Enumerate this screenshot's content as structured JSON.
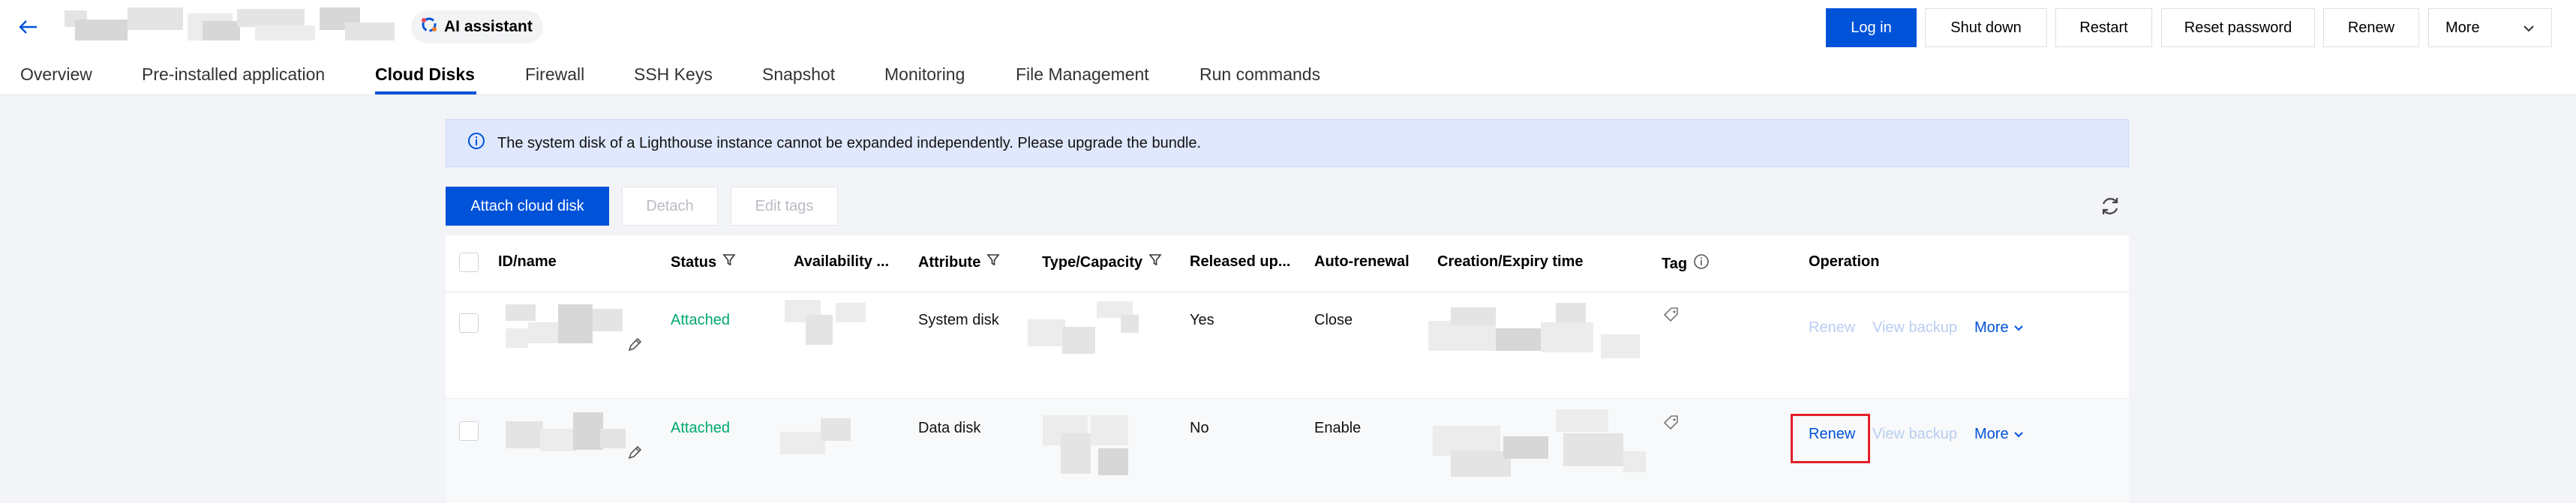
{
  "header": {
    "ai_assistant_label": "AI assistant",
    "buttons": {
      "login": "Log in",
      "shutdown": "Shut down",
      "restart": "Restart",
      "reset_password": "Reset password",
      "renew": "Renew",
      "more": "More"
    }
  },
  "tabs": [
    {
      "label": "Overview"
    },
    {
      "label": "Pre-installed application"
    },
    {
      "label": "Cloud Disks",
      "active": true
    },
    {
      "label": "Firewall"
    },
    {
      "label": "SSH Keys"
    },
    {
      "label": "Snapshot"
    },
    {
      "label": "Monitoring"
    },
    {
      "label": "File Management"
    },
    {
      "label": "Run commands"
    }
  ],
  "notice": {
    "text": "The system disk of a Lighthouse instance cannot be expanded independently. Please upgrade the bundle."
  },
  "toolbar": {
    "attach_label": "Attach cloud disk",
    "detach_label": "Detach",
    "edit_tags_label": "Edit tags"
  },
  "table": {
    "columns": {
      "id_name": "ID/name",
      "status": "Status",
      "availability": "Availability ...",
      "attribute": "Attribute",
      "type_capacity": "Type/Capacity",
      "released": "Released up...",
      "auto_renewal": "Auto-renewal",
      "creation_expiry": "Creation/Expiry time",
      "tag": "Tag",
      "operation": "Operation"
    },
    "rows": [
      {
        "status": "Attached",
        "attribute": "System disk",
        "released": "Yes",
        "auto_renewal": "Close",
        "ops": {
          "renew": "Renew",
          "view_backup": "View backup",
          "more": "More"
        }
      },
      {
        "status": "Attached",
        "attribute": "Data disk",
        "released": "No",
        "auto_renewal": "Enable",
        "ops": {
          "renew": "Renew",
          "view_backup": "View backup",
          "more": "More"
        }
      }
    ]
  },
  "colors": {
    "primary": "#0052d9",
    "success": "#00a870",
    "highlight": "#e1212a",
    "notice_bg": "#dfe8fc"
  },
  "icons": [
    "back-arrow-icon",
    "ai-assistant-icon",
    "chevron-down-icon",
    "info-icon",
    "refresh-icon",
    "filter-icon",
    "edit-pencil-icon",
    "tag-icon"
  ]
}
